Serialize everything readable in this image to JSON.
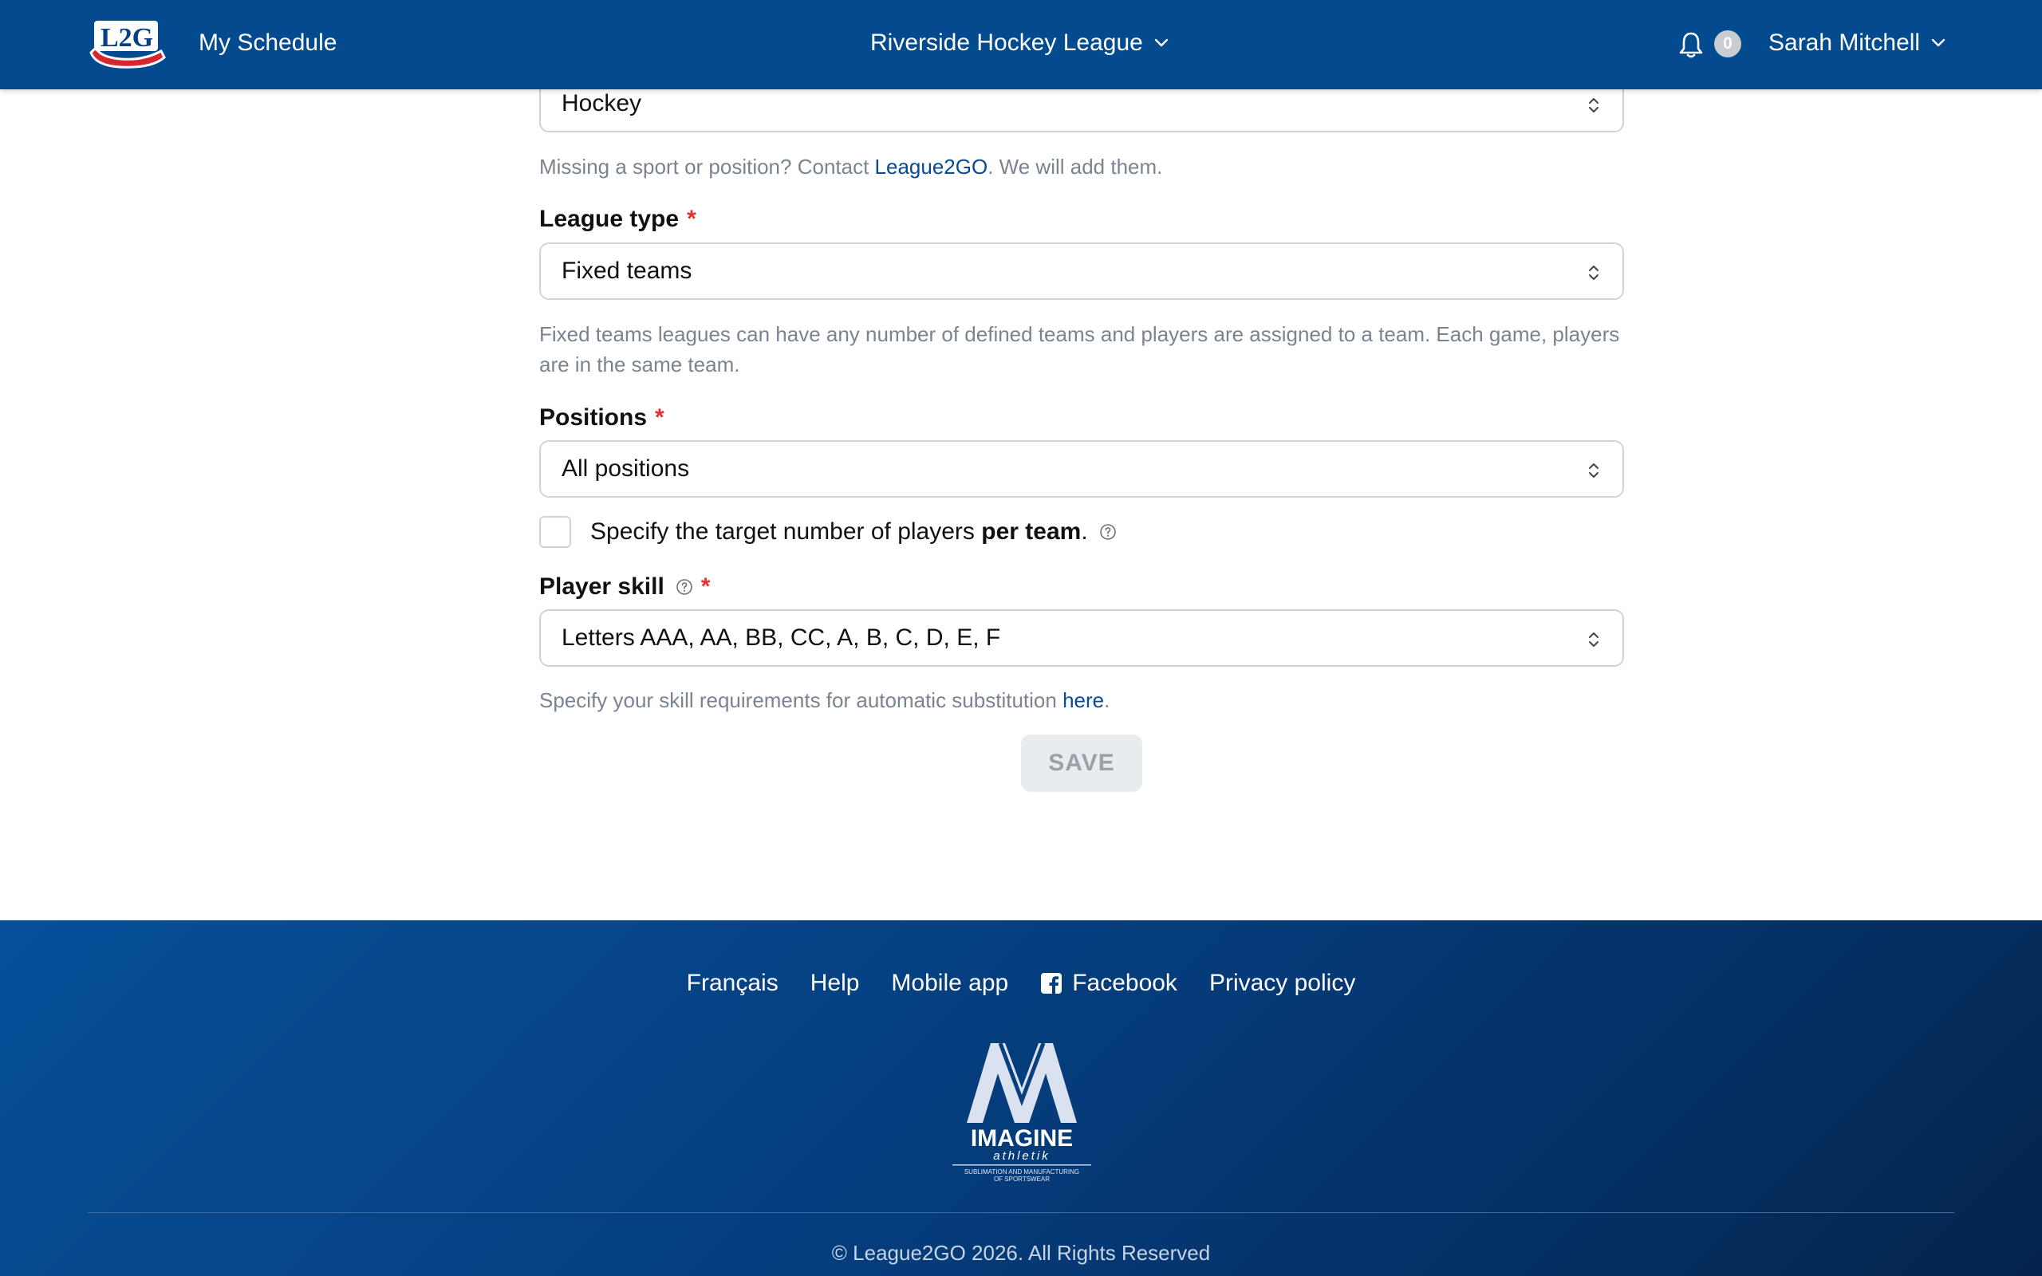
{
  "navbar": {
    "logo_text": "L2G",
    "my_schedule": "My Schedule",
    "league_name": "Riverside Hockey League",
    "notification_count": "0",
    "user_name": "Sarah Mitchell"
  },
  "form": {
    "sport": {
      "value": "Hockey",
      "help_prefix": "Missing a sport or position? Contact ",
      "help_link": "League2GO",
      "help_suffix": ". We will add them."
    },
    "league_type": {
      "label": "League type",
      "required": "*",
      "value": "Fixed teams",
      "help": "Fixed teams leagues can have any number of defined teams and players are assigned to a team. Each game, players are in the same team."
    },
    "positions": {
      "label": "Positions",
      "required": "*",
      "value": "All positions"
    },
    "target_players": {
      "label_prefix": "Specify the target number of players ",
      "label_bold": "per team",
      "label_suffix": ".",
      "checked": false
    },
    "player_skill": {
      "label": "Player skill",
      "required": "*",
      "value": "Letters AAA, AA, BB, CC, A, B, C, D, E, F",
      "help_prefix": "Specify your skill requirements for automatic substitution ",
      "help_link": "here",
      "help_suffix": "."
    },
    "save_label": "SAVE"
  },
  "footer": {
    "links": {
      "francais": "Français",
      "help": "Help",
      "mobile_app": "Mobile app",
      "facebook": "Facebook",
      "privacy": "Privacy policy"
    },
    "sponsor": {
      "name": "IMAGINE",
      "sub": "athletik",
      "tagline_1": "SUBLIMATION AND MANUFACTURING",
      "tagline_2": "OF SPORTSWEAR"
    },
    "copyright": "© League2GO 2026. All Rights Reserved"
  },
  "colors": {
    "navbar": "#044a8f",
    "link": "#0a4a94",
    "required": "#e03131",
    "footer_start": "#06509a",
    "footer_end": "#04244d"
  },
  "icons": [
    "l2g-logo",
    "chevron-down-icon",
    "bell-icon",
    "updown-icon",
    "question-icon",
    "facebook-icon",
    "imagine-athletik-logo"
  ]
}
